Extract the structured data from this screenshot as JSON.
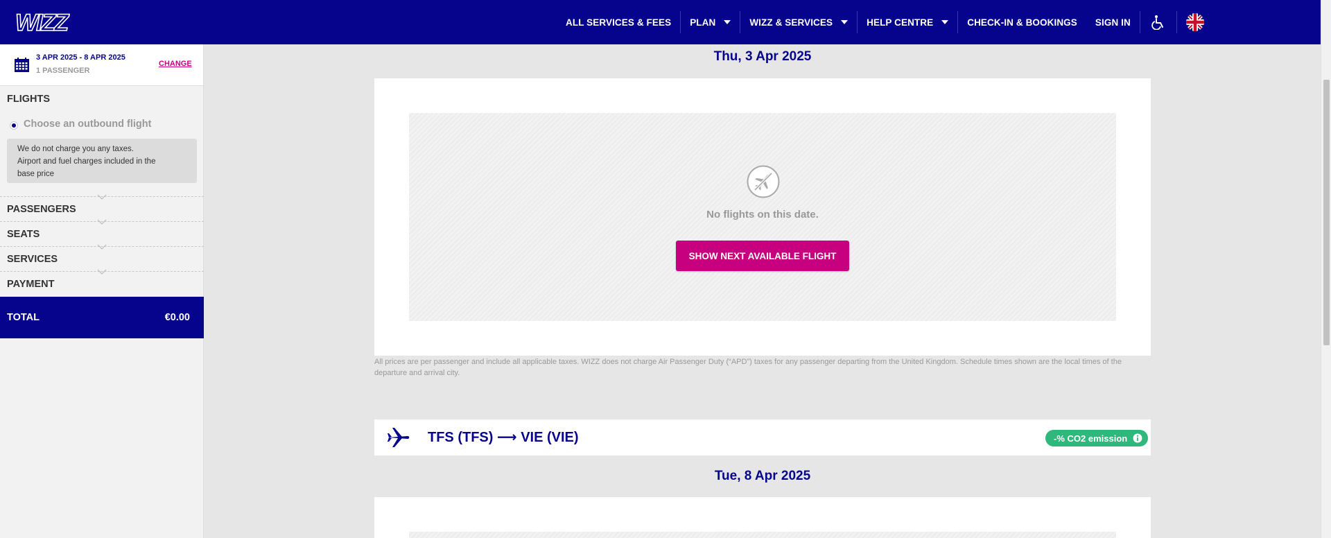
{
  "header": {
    "logo_text": "WIZZ",
    "nav": [
      {
        "label": "ALL SERVICES & FEES",
        "dropdown": false
      },
      {
        "label": "PLAN",
        "dropdown": true
      },
      {
        "label": "WIZZ & SERVICES",
        "dropdown": true
      },
      {
        "label": "HELP CENTRE",
        "dropdown": true
      },
      {
        "label": "CHECK-IN & BOOKINGS",
        "dropdown": false
      },
      {
        "label": "SIGN IN",
        "dropdown": false
      }
    ],
    "accessibility_icon": "wheelchair-icon",
    "language_icon": "uk-flag-icon"
  },
  "sidebar": {
    "date_range": "3 APR 2025 - 8 APR 2025",
    "passengers": "1 PASSENGER",
    "change_label": "CHANGE",
    "flights_title": "FLIGHTS",
    "choose_outbound": "Choose an outbound flight",
    "tax_note": [
      "We do not charge you any taxes.",
      "Airport and fuel charges included in the",
      "base price"
    ],
    "steps": [
      "PASSENGERS",
      "SEATS",
      "SERVICES",
      "PAYMENT"
    ],
    "total_label": "TOTAL",
    "total_value": "€0.00"
  },
  "outbound": {
    "date": "Thu, 3 Apr 2025",
    "no_flights": "No flights on this date.",
    "next_button": "SHOW NEXT AVAILABLE FLIGHT"
  },
  "disclaimer": "All prices are per passenger and include all applicable taxes. WIZZ does not charge Air Passenger Duty (“APD”) taxes for any passenger departing from the United Kingdom. Schedule times shown are the local times of the departure and arrival city.",
  "return": {
    "route": "TFS (TFS) ⟶ VIE (VIE)",
    "co2_badge": "-% CO2 emission",
    "date": "Tue, 8 Apr 2025"
  },
  "colors": {
    "brand_navy": "#06038d",
    "brand_magenta": "#c6007e",
    "co2_green": "#2eb87c"
  }
}
